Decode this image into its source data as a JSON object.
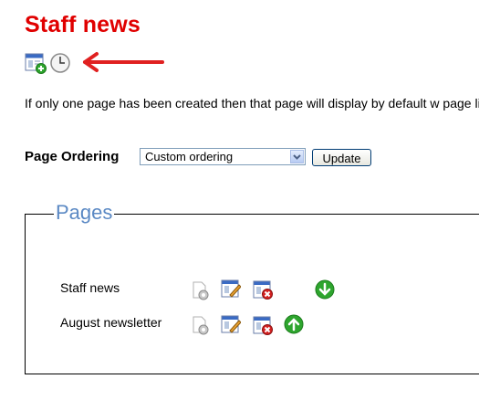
{
  "page": {
    "title": "Staff news",
    "intro_text": "If only one page has been created then that page will display by default w page list (table of contents)."
  },
  "toolbar": {
    "icons": [
      "add-page-icon",
      "clock-icon"
    ],
    "pointer": "red-arrow-icon"
  },
  "ordering": {
    "label": "Page Ordering",
    "selected": "Custom ordering",
    "update_label": "Update"
  },
  "pages": {
    "legend": "Pages",
    "items": [
      {
        "title": "Staff news",
        "actions": [
          "settings-icon",
          "edit-icon",
          "delete-icon",
          "move-down-icon"
        ]
      },
      {
        "title": "August newsletter",
        "actions": [
          "settings-icon",
          "edit-icon",
          "delete-icon",
          "move-up-icon"
        ]
      }
    ]
  },
  "colors": {
    "title": "#e00000",
    "legend": "#5b89c4",
    "arrow": "#e02020",
    "move": "#2ea52e"
  }
}
